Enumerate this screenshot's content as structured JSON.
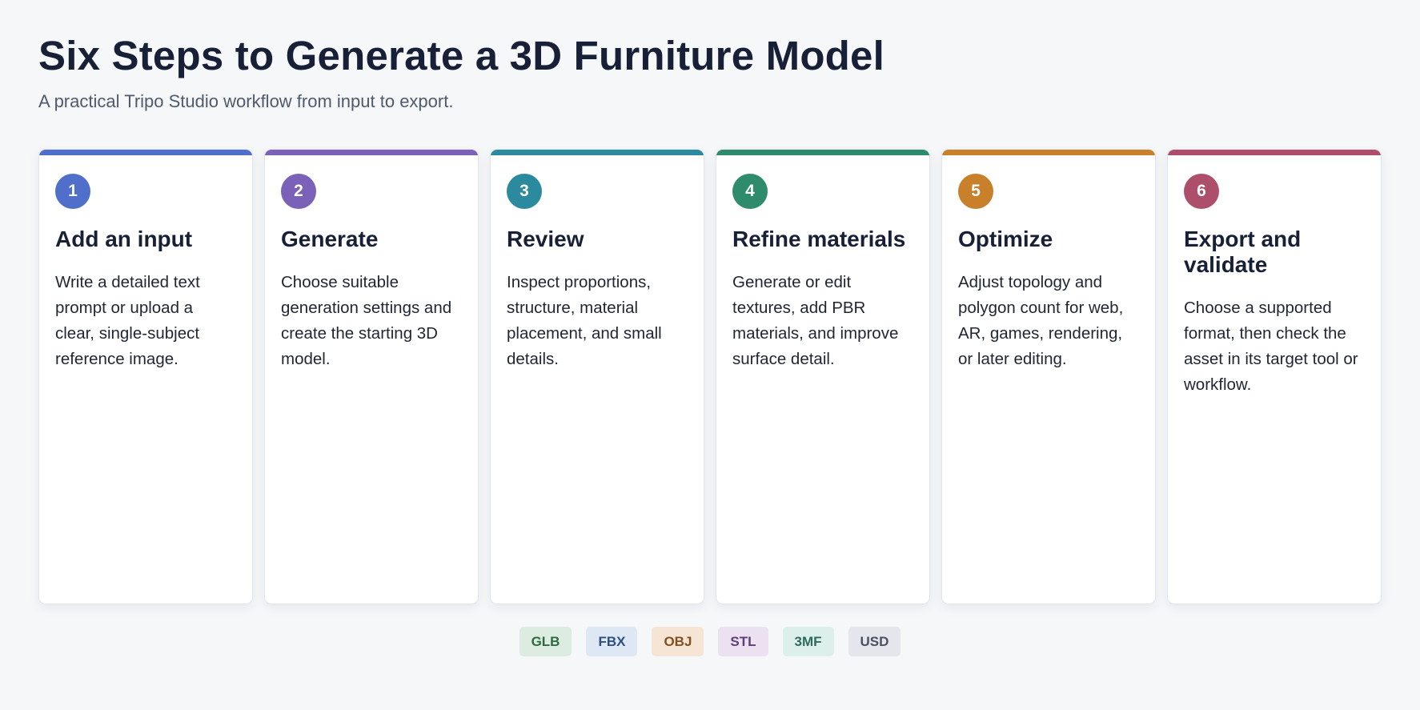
{
  "header": {
    "title": "Six Steps to Generate a 3D Furniture Model",
    "subtitle": "A practical Tripo Studio workflow from input to export."
  },
  "steps": [
    {
      "number": "1",
      "title": "Add an input",
      "description": "Write a detailed text prompt or upload a clear, single-subject reference image.",
      "color": "#4f6fcb"
    },
    {
      "number": "2",
      "title": "Generate",
      "description": "Choose suitable generation settings and create the starting 3D model.",
      "color": "#7b62b8"
    },
    {
      "number": "3",
      "title": "Review",
      "description": "Inspect proportions, structure, material placement, and small details.",
      "color": "#2b8a9e"
    },
    {
      "number": "4",
      "title": "Refine materials",
      "description": "Generate or edit textures, add PBR materials, and improve surface detail.",
      "color": "#2e8b6b"
    },
    {
      "number": "5",
      "title": "Optimize",
      "description": "Adjust topology and polygon count for web, AR, games, rendering, or later editing.",
      "color": "#c8812a"
    },
    {
      "number": "6",
      "title": "Export and validate",
      "description": "Choose a supported format, then check the asset in its target tool or workflow.",
      "color": "#ad4f6a"
    }
  ],
  "formats": [
    {
      "label": "GLB",
      "bg": "#dcece0",
      "fg": "#2d6b3f"
    },
    {
      "label": "FBX",
      "bg": "#dde8f4",
      "fg": "#2d4f82"
    },
    {
      "label": "OBJ",
      "bg": "#f6e5d5",
      "fg": "#82501f"
    },
    {
      "label": "STL",
      "bg": "#ebe1f1",
      "fg": "#5f3c7a"
    },
    {
      "label": "3MF",
      "bg": "#dcefeb",
      "fg": "#2d6b60"
    },
    {
      "label": "USD",
      "bg": "#e4e6ec",
      "fg": "#4a5163"
    }
  ]
}
